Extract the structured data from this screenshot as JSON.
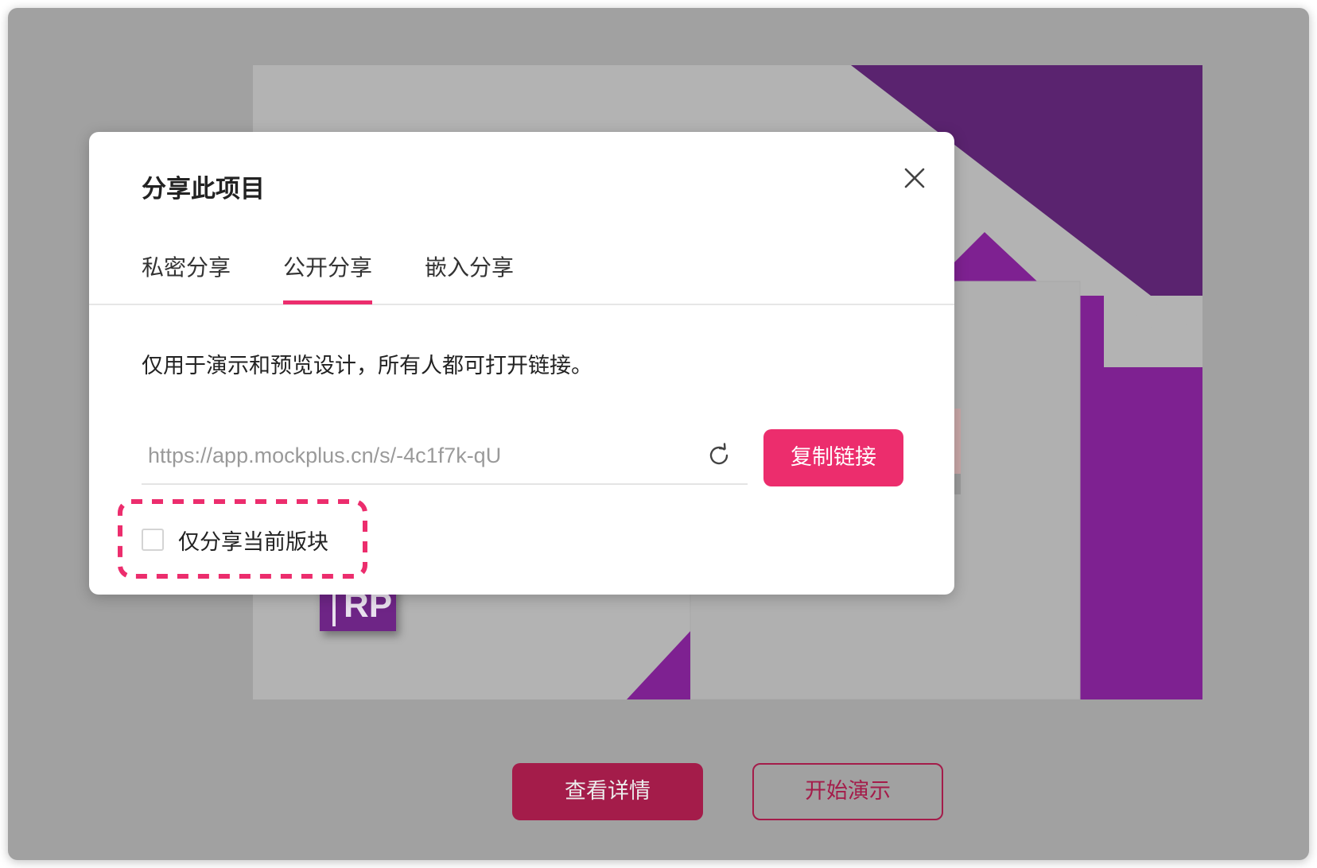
{
  "preview": {
    "logo_text": "RP"
  },
  "actions": {
    "view_details_label": "查看详情",
    "start_presentation_label": "开始演示"
  },
  "dialog": {
    "title": "分享此项目",
    "tabs": [
      {
        "label": "私密分享",
        "active": false
      },
      {
        "label": "公开分享",
        "active": true
      },
      {
        "label": "嵌入分享",
        "active": false
      }
    ],
    "description": "仅用于演示和预览设计，所有人都可打开链接。",
    "link_value": "https://app.mockplus.cn/s/-4c1f7k-qU",
    "copy_button_label": "复制链接",
    "only_current_block_label": "仅分享当前版块",
    "only_current_block_checked": false
  },
  "colors": {
    "accent": "#ec2d6d",
    "overlay_accent": "#a41c4a",
    "purple_dark": "#5a236f",
    "purple": "#7e2191"
  }
}
